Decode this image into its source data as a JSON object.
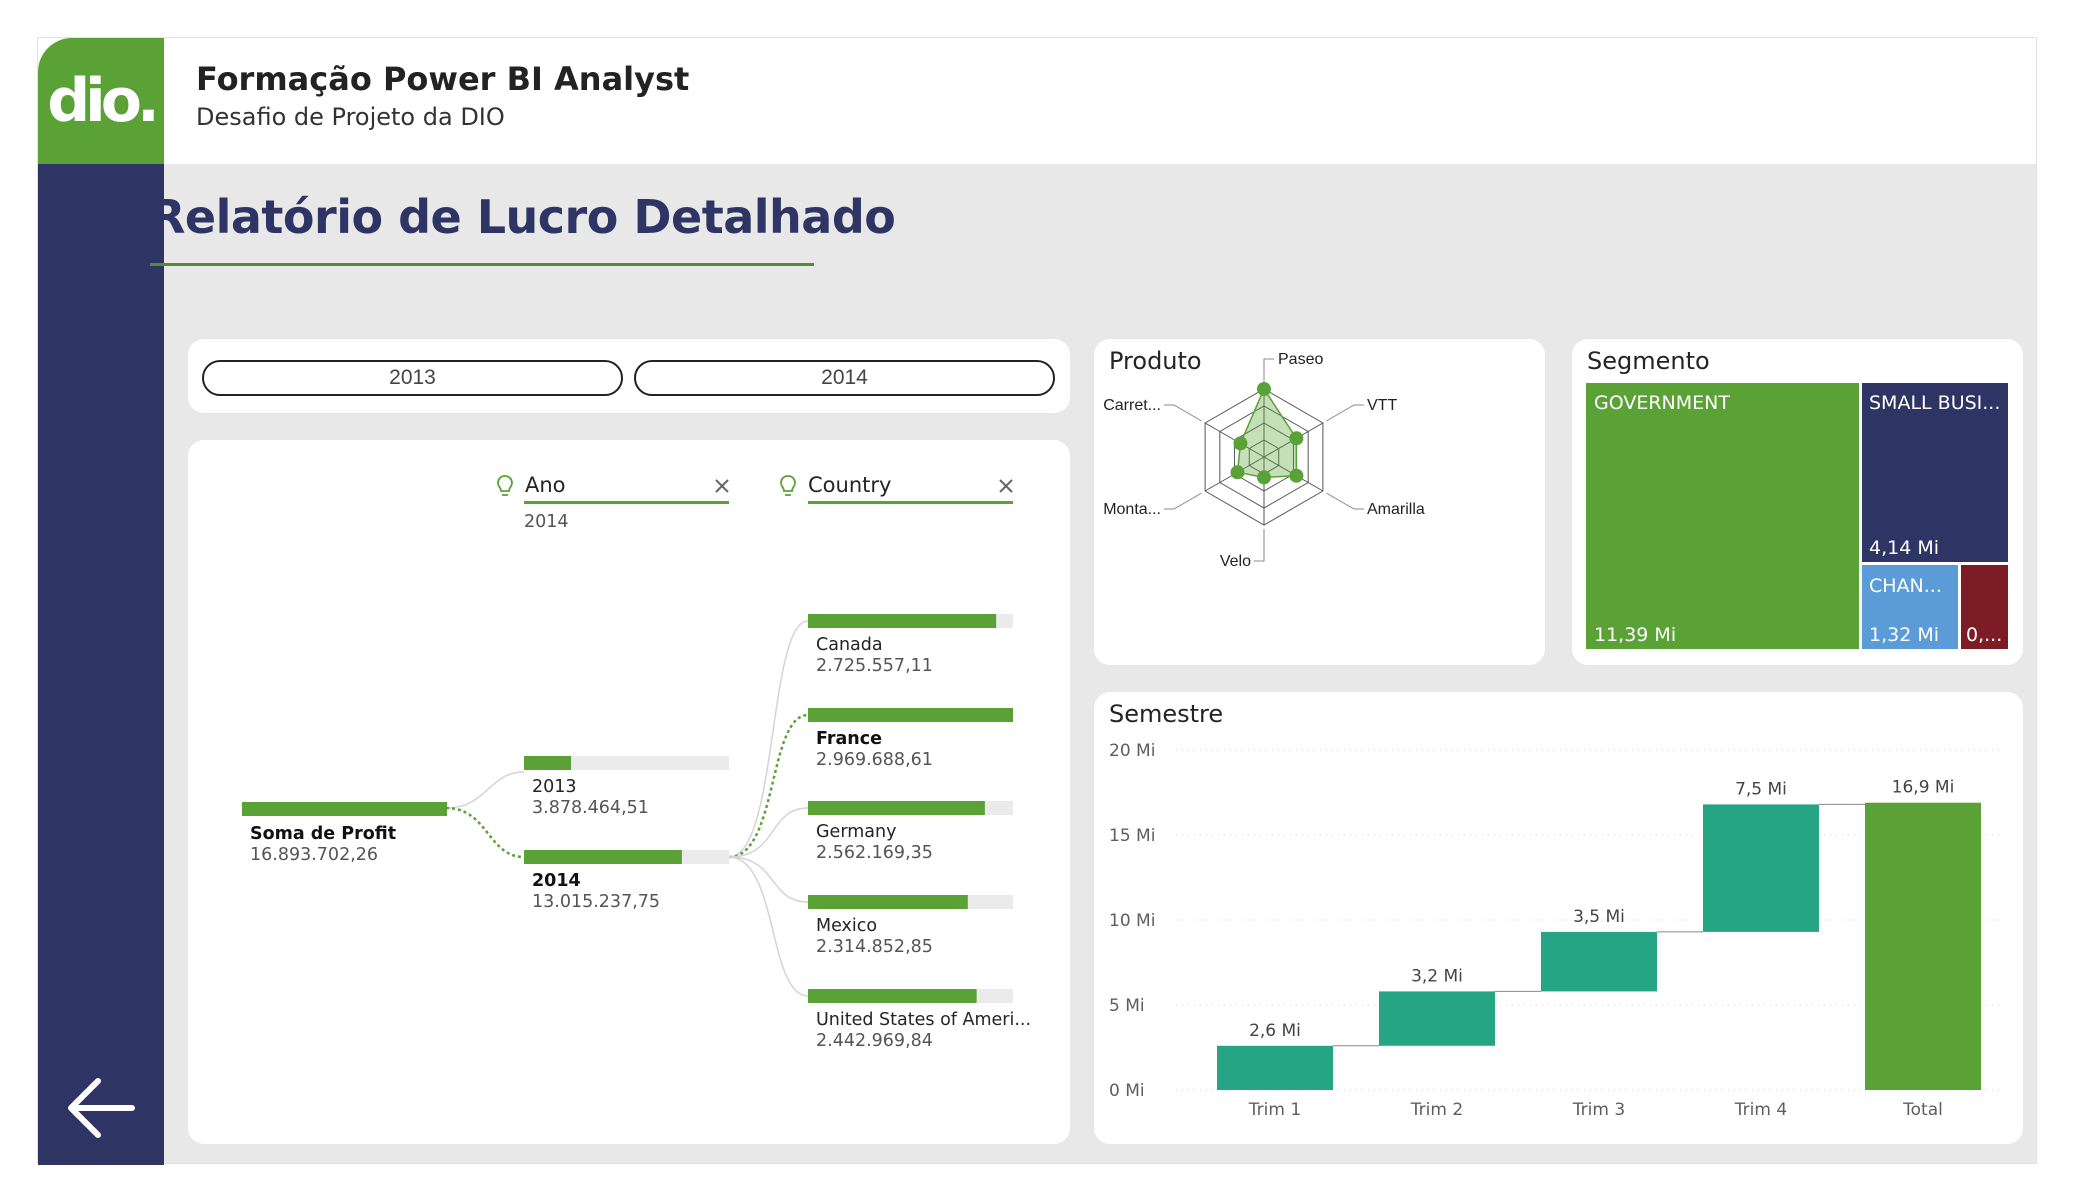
{
  "header": {
    "logo_text": "dio.",
    "title": "Formação Power BI Analyst",
    "subtitle": "Desafio de Projeto da DIO"
  },
  "report": {
    "title": "Relatório de Lucro Detalhado"
  },
  "colors": {
    "green": "#5aa236",
    "navy": "#2e3565",
    "teal": "#26a584",
    "light_blue": "#5a9bd8",
    "maroon": "#7c1d25",
    "track": "#ebebeb"
  },
  "year_slicer": {
    "options": [
      "2013",
      "2014"
    ]
  },
  "decomposition_tree": {
    "levels": [
      {
        "name": "Ano",
        "selected": "2014"
      },
      {
        "name": "Country",
        "selected": ""
      }
    ],
    "root": {
      "label": "Soma de Profit",
      "value": "16.893.702,26",
      "raw": 16893702.26
    },
    "years": [
      {
        "label": "2013",
        "value": "3.878.464,51",
        "raw": 3878464.51,
        "selected": false
      },
      {
        "label": "2014",
        "value": "13.015.237,75",
        "raw": 13015237.75,
        "selected": true
      }
    ],
    "countries": [
      {
        "label": "Canada",
        "value": "2.725.557,11",
        "raw": 2725557.11,
        "selected": false
      },
      {
        "label": "France",
        "value": "2.969.688,61",
        "raw": 2969688.61,
        "selected": true
      },
      {
        "label": "Germany",
        "value": "2.562.169,35",
        "raw": 2562169.35,
        "selected": false
      },
      {
        "label": "Mexico",
        "value": "2.314.852,85",
        "raw": 2314852.85,
        "selected": false
      },
      {
        "label": "United States of Ameri...",
        "value": "2.442.969,84",
        "raw": 2442969.84,
        "selected": false
      }
    ]
  },
  "produto": {
    "title": "Produto",
    "chart_data": {
      "type": "radar",
      "categories": [
        "Paseo",
        "VTT",
        "Amarilla",
        "Velo",
        "Monta...",
        "Carret..."
      ],
      "values": [
        1.0,
        0.55,
        0.55,
        0.3,
        0.45,
        0.4
      ]
    }
  },
  "segmento": {
    "title": "Segmento",
    "chart_data": {
      "type": "treemap",
      "items": [
        {
          "label": "GOVERNMENT",
          "value_label": "11,39 Mi",
          "value": 11.39,
          "color": "#5aa236"
        },
        {
          "label": "SMALL BUSI...",
          "value_label": "4,14 Mi",
          "value": 4.14,
          "color": "#2e3565"
        },
        {
          "label": "CHAN...",
          "value_label": "1,32 Mi",
          "value": 1.32,
          "color": "#5a9bd8"
        },
        {
          "label": "",
          "value_label": "0,...",
          "value": 0.6,
          "color": "#7c1d25"
        }
      ]
    }
  },
  "semestre": {
    "title": "Semestre",
    "chart_data": {
      "type": "waterfall",
      "categories": [
        "Trim 1",
        "Trim 2",
        "Trim 3",
        "Trim 4",
        "Total"
      ],
      "values": [
        2.6,
        3.2,
        3.5,
        7.5,
        16.9
      ],
      "data_labels": [
        "2,6 Mi",
        "3,2 Mi",
        "3,5 Mi",
        "7,5 Mi",
        "16,9 Mi"
      ],
      "yticks": [
        "0 Mi",
        "5 Mi",
        "10 Mi",
        "15 Mi",
        "20 Mi"
      ],
      "ylim": [
        0,
        20
      ],
      "grid": true
    }
  }
}
